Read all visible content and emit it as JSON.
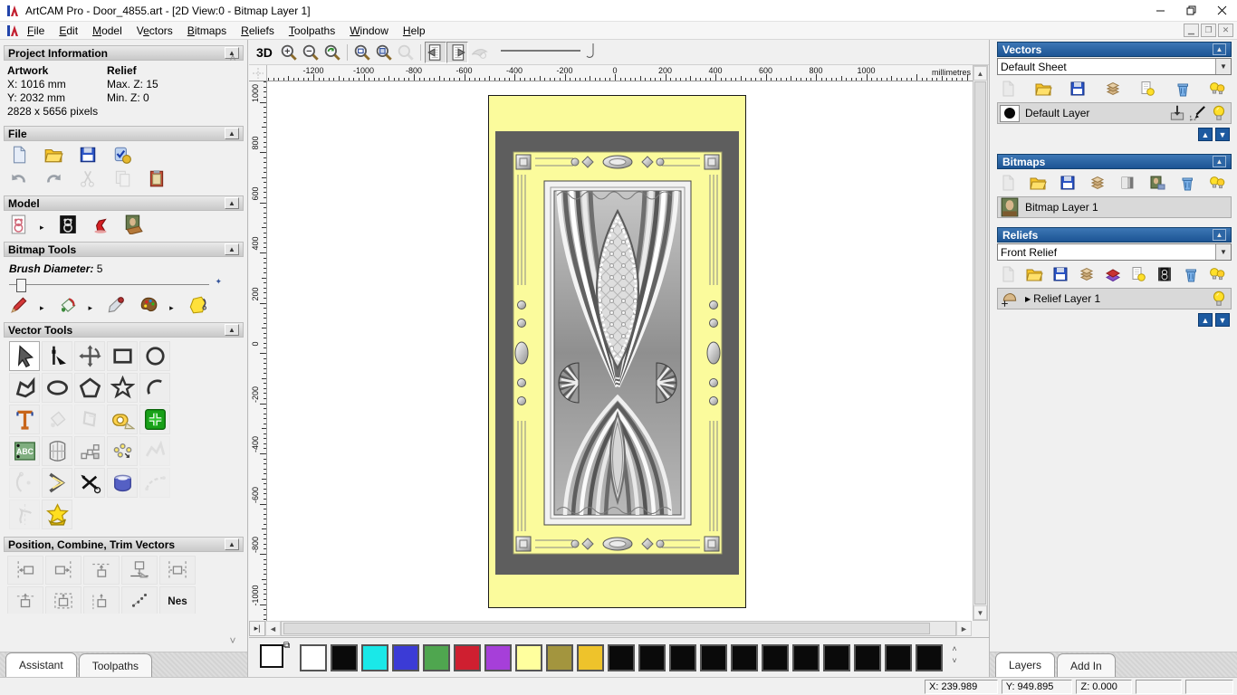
{
  "window": {
    "title": "ArtCAM Pro - Door_4855.art - [2D View:0 - Bitmap Layer 1]"
  },
  "menubar": {
    "items": [
      {
        "label": "File",
        "u": 0
      },
      {
        "label": "Edit",
        "u": 0
      },
      {
        "label": "Model",
        "u": 0
      },
      {
        "label": "Vectors",
        "u": 1
      },
      {
        "label": "Bitmaps",
        "u": 0
      },
      {
        "label": "Reliefs",
        "u": 0
      },
      {
        "label": "Toolpaths",
        "u": 0
      },
      {
        "label": "Window",
        "u": 0
      },
      {
        "label": "Help",
        "u": 0
      }
    ]
  },
  "assistant": {
    "project_info": {
      "title": "Project Information",
      "artwork_label": "Artwork",
      "relief_label": "Relief",
      "x": "X: 1016 mm",
      "y": "Y: 2032 mm",
      "pixels": "2828 x 5656 pixels",
      "max_z": "Max. Z: 15",
      "min_z": "Min. Z: 0"
    },
    "file": {
      "title": "File",
      "row1": [
        {
          "n": "new-document-icon"
        },
        {
          "n": "open-folder-icon"
        },
        {
          "n": "save-icon"
        },
        {
          "n": "model-check-icon"
        }
      ],
      "row2": [
        {
          "n": "undo-icon"
        },
        {
          "n": "redo-icon"
        },
        {
          "n": "cut-icon",
          "d": true
        },
        {
          "n": "paste-icon",
          "d": true
        },
        {
          "n": "clipboard-icon"
        }
      ]
    },
    "model": {
      "title": "Model",
      "icons": [
        {
          "n": "teddy-doc-icon",
          "f": true
        },
        {
          "n": "teddy-dark-icon"
        },
        {
          "n": "lamp-icon"
        },
        {
          "n": "mona-icon"
        }
      ]
    },
    "bitmap_tools": {
      "title": "Bitmap Tools",
      "brush_label": "Brush Diameter:",
      "brush_value": "5",
      "icons": [
        {
          "n": "paint-pen-icon",
          "f": true
        },
        {
          "n": "flood-fill-icon",
          "f": true
        },
        {
          "n": "eyedropper-icon"
        },
        {
          "n": "palette-icon",
          "f": true
        },
        {
          "n": "texture-icon"
        }
      ]
    },
    "vector_tools": {
      "title": "Vector Tools",
      "icons": [
        {
          "n": "select-icon",
          "a": true
        },
        {
          "n": "node-edit-icon"
        },
        {
          "n": "transform-icon"
        },
        {
          "n": "rectangle-icon"
        },
        {
          "n": "circle-icon"
        },
        {
          "n": "polyline-icon"
        },
        {
          "n": "ellipse-icon"
        },
        {
          "n": "polygon-icon"
        },
        {
          "n": "star-icon"
        },
        {
          "n": "arc-icon"
        },
        {
          "n": "text-icon"
        },
        {
          "n": "vector-fill-icon",
          "d": true
        },
        {
          "n": "offset-icon",
          "d": true
        },
        {
          "n": "measure-icon"
        },
        {
          "n": "add-clipart-icon"
        },
        {
          "n": "text-block-icon"
        },
        {
          "n": "distort-icon"
        },
        {
          "n": "block-copy-icon"
        },
        {
          "n": "nudge-icon"
        },
        {
          "n": "fit-vectors-icon",
          "d": true
        },
        {
          "n": "arc-fit-icon",
          "d": true
        },
        {
          "n": "bisector-icon"
        },
        {
          "n": "trim-icon"
        },
        {
          "n": "extrude-icon"
        },
        {
          "n": "join-icon",
          "d": true
        },
        {
          "n": "section-icon",
          "d": true
        },
        {
          "n": "wrap-star-icon"
        }
      ]
    },
    "position": {
      "title": "Position, Combine, Trim Vectors",
      "icons": [
        {
          "n": "align-left-icon"
        },
        {
          "n": "align-right-icon"
        },
        {
          "n": "align-top-icon"
        },
        {
          "n": "align-bottom-icon"
        },
        {
          "n": "align-center-icon"
        },
        {
          "n": "align-t1-icon"
        },
        {
          "n": "align-t2-icon"
        },
        {
          "n": "align-t3-icon"
        },
        {
          "n": "scatter-icon"
        },
        {
          "n": "nesting-icon"
        }
      ]
    },
    "tabs": [
      {
        "label": "Assistant",
        "active": true
      },
      {
        "label": "Toolpaths",
        "active": false
      }
    ]
  },
  "view": {
    "toolbar": {
      "btn_3d": "3D",
      "icons": [
        {
          "n": "zoom-in-icon"
        },
        {
          "n": "zoom-out-icon"
        },
        {
          "n": "zoom-previous-icon"
        },
        {
          "n": "zoom-fit-icon",
          "sep": true
        },
        {
          "n": "zoom-object-icon"
        },
        {
          "n": "zoom-disabled-icon",
          "d": true
        },
        {
          "n": "page-left-icon",
          "p": true,
          "sep": true
        },
        {
          "n": "page-right-icon",
          "p": true
        },
        {
          "n": "fly-cursor-icon",
          "d": true
        }
      ]
    },
    "ruler_unit": "millimetres",
    "h_labels": [
      -1200,
      -1000,
      -800,
      -600,
      -400,
      -200,
      0,
      200,
      400,
      600,
      800,
      1000
    ],
    "v_labels": [
      1000,
      800,
      600,
      400,
      200,
      0,
      -200,
      -400,
      -600,
      -800,
      -1000
    ]
  },
  "palette": {
    "colors": [
      "#ffffff",
      "#0a0a0a",
      "#1ae8e8",
      "#3b3bd6",
      "#4fa64f",
      "#cf1f30",
      "#a63fd9",
      "#ffff9e",
      "#a3953e",
      "#eec32b",
      "#0a0a0a",
      "#0a0a0a",
      "#0a0a0a",
      "#0a0a0a",
      "#0a0a0a",
      "#0a0a0a",
      "#0a0a0a",
      "#0a0a0a",
      "#0a0a0a",
      "#0a0a0a",
      "#0a0a0a"
    ]
  },
  "panels": {
    "vectors": {
      "title": "Vectors",
      "sheet": "Default Sheet",
      "toolbar": [
        {
          "n": "sheet-doc-icon",
          "d": true
        },
        {
          "n": "open-folder-icon"
        },
        {
          "n": "save-icon"
        },
        {
          "n": "merge-stack-icon"
        },
        {
          "n": "bulb-doc-icon"
        },
        {
          "n": "trash-icon"
        },
        {
          "n": "bulbs-all-icon"
        }
      ],
      "layer": "Default Layer",
      "layer_buttons": [
        {
          "n": "merge-up-icon"
        },
        {
          "n": "edit-snap-icon"
        },
        {
          "n": "bulb-icon"
        }
      ]
    },
    "bitmaps": {
      "title": "Bitmaps",
      "toolbar": [
        {
          "n": "sheet-doc-icon",
          "d": true
        },
        {
          "n": "open-folder-icon"
        },
        {
          "n": "save-icon"
        },
        {
          "n": "merge-stack-icon"
        },
        {
          "n": "gradient-square-icon"
        },
        {
          "n": "mona-small-icon"
        },
        {
          "n": "trash-icon"
        },
        {
          "n": "bulbs-all-icon"
        }
      ],
      "layer": "Bitmap Layer 1"
    },
    "reliefs": {
      "title": "Reliefs",
      "combo": "Front Relief",
      "toolbar": [
        {
          "n": "sheet-doc-icon",
          "d": true
        },
        {
          "n": "open-folder-icon"
        },
        {
          "n": "save-icon"
        },
        {
          "n": "merge-stack-icon"
        },
        {
          "n": "relief-layers-icon"
        },
        {
          "n": "bulb-doc-icon"
        },
        {
          "n": "teddy-film-icon"
        },
        {
          "n": "trash-icon"
        },
        {
          "n": "bulbs-all-icon"
        }
      ],
      "layer": "Relief Layer 1",
      "layer_buttons": [
        {
          "n": "bulb-icon"
        }
      ]
    },
    "tabs": [
      {
        "label": "Layers",
        "active": true
      },
      {
        "label": "Add In",
        "active": false
      }
    ]
  },
  "status": {
    "x": "X: 239.989",
    "y": "Y: 949.895",
    "z": "Z: 0.000"
  }
}
